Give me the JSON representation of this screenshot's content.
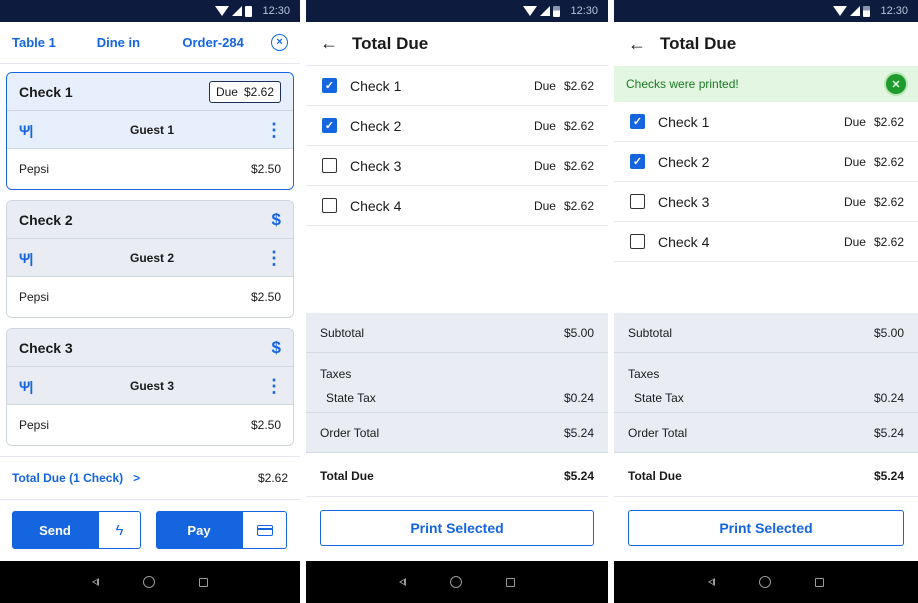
{
  "status": {
    "time": "12:30"
  },
  "screen1": {
    "header": {
      "table": "Table 1",
      "dine": "Dine in",
      "order": "Order-284",
      "close_glyph": "×"
    },
    "checks": [
      {
        "title": "Check 1",
        "due_label": "Due",
        "due_amount": "$2.62",
        "guest": "Guest 1",
        "item": "Pepsi",
        "price": "$2.50"
      },
      {
        "title": "Check 2",
        "dollar": "$",
        "guest": "Guest 2",
        "item": "Pepsi",
        "price": "$2.50"
      },
      {
        "title": "Check 3",
        "dollar": "$",
        "guest": "Guest 3",
        "item": "Pepsi",
        "price": "$2.50"
      }
    ],
    "total_due": {
      "label": "Total Due (1 Check)",
      "chevron": ">",
      "amount": "$2.62"
    },
    "actions": {
      "send": "Send",
      "bolt": "ϟ",
      "pay": "Pay"
    }
  },
  "screen2": {
    "title": "Total Due",
    "back": "←",
    "checks": [
      {
        "label": "Check 1",
        "due_label": "Due",
        "amount": "$2.62",
        "checked": true
      },
      {
        "label": "Check 2",
        "due_label": "Due",
        "amount": "$2.62",
        "checked": true
      },
      {
        "label": "Check 3",
        "due_label": "Due",
        "amount": "$2.62",
        "checked": false
      },
      {
        "label": "Check 4",
        "due_label": "Due",
        "amount": "$2.62",
        "checked": false
      }
    ],
    "summary": {
      "subtotal_label": "Subtotal",
      "subtotal": "$5.00",
      "taxes_label": "Taxes",
      "state_tax_label": "State Tax",
      "state_tax": "$0.24",
      "order_total_label": "Order Total",
      "order_total": "$5.24",
      "total_due_label": "Total Due",
      "total_due": "$5.24"
    },
    "print_button": "Print Selected"
  },
  "screen3": {
    "title": "Total Due",
    "back": "←",
    "banner": "Checks were printed!",
    "checks": [
      {
        "label": "Check 1",
        "due_label": "Due",
        "amount": "$2.62",
        "checked": true
      },
      {
        "label": "Check 2",
        "due_label": "Due",
        "amount": "$2.62",
        "checked": true
      },
      {
        "label": "Check 3",
        "due_label": "Due",
        "amount": "$2.62",
        "checked": false
      },
      {
        "label": "Check 4",
        "due_label": "Due",
        "amount": "$2.62",
        "checked": false
      }
    ],
    "summary": {
      "subtotal_label": "Subtotal",
      "subtotal": "$5.00",
      "taxes_label": "Taxes",
      "state_tax_label": "State Tax",
      "state_tax": "$0.24",
      "order_total_label": "Order Total",
      "order_total": "$5.24",
      "total_due_label": "Total Due",
      "total_due": "$5.24"
    },
    "print_button": "Print Selected"
  },
  "colors": {
    "accent": "#1565e0",
    "status_bar": "#0d1b3e",
    "success": "#1f9a2d",
    "panel": "#e9edf3"
  },
  "icons": [
    "wifi-icon",
    "cell-signal-icon",
    "battery-icon",
    "close-circle-icon",
    "fork-knife-icon",
    "kebab-menu-icon",
    "dollar-icon",
    "chevron-right-icon",
    "lightning-icon",
    "credit-card-icon",
    "back-arrow-icon",
    "checkbox-icon",
    "success-close-icon",
    "nav-back-icon",
    "nav-home-icon",
    "nav-recent-icon"
  ]
}
